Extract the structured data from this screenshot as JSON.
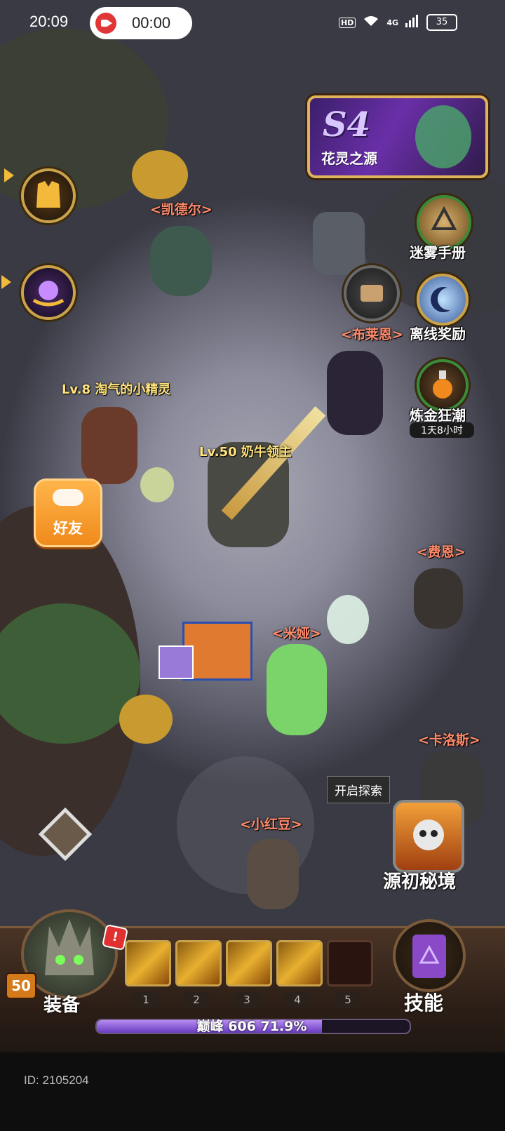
{
  "status_bar": {
    "time": "20:09",
    "recording_time": "00:00",
    "hd": "HD",
    "network": "4G",
    "battery": "35"
  },
  "banner": {
    "season": "S4",
    "title": "花灵之源"
  },
  "left_buttons": [
    {
      "name": "armor",
      "icon": "armor-icon"
    },
    {
      "name": "magic-orb",
      "icon": "orb-icon"
    }
  ],
  "right_features": {
    "mist_manual": "迷雾手册",
    "bryan": "<布莱恩>",
    "offline_reward": "离线奖励",
    "alchemy": "炼金狂潮",
    "alchemy_timer": "1天8小时"
  },
  "npcs": {
    "kaider": "<凯德尔>",
    "fei_en": "<费恩>",
    "mia": "<米娅>",
    "carlos": "<卡洛斯>",
    "little_red_bean": "<小红豆>"
  },
  "characters": {
    "sprite": "Lv.8 淘气的小精灵",
    "boss": "Lv.50 奶牛领主"
  },
  "friend_button": "好友",
  "explore": {
    "tip": "开启探索",
    "dungeon": "源初秘境"
  },
  "bottom_bar": {
    "equipment": "装备",
    "skills": "技能",
    "player_level": "50",
    "alert": "!",
    "slots": [
      "1",
      "2",
      "3",
      "4",
      "5"
    ],
    "xp_label": "巅峰 606  71.9%",
    "xp_fraction": 0.719
  },
  "id_text": "ID: 2105204",
  "colors": {
    "accent_gold": "#c9a24a",
    "npc_name": "#ff8a6a",
    "level_name": "#ffe37a",
    "xp_purple": "#8a5ad8"
  }
}
